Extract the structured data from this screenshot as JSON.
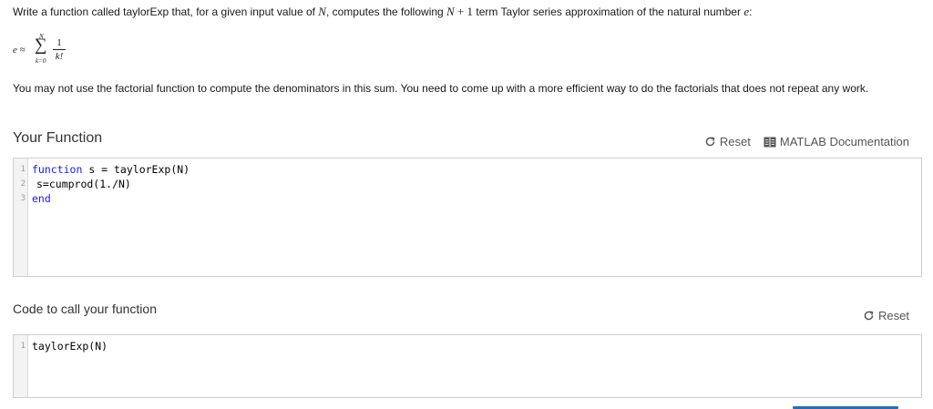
{
  "problem": {
    "text_1": "Write a function called taylorExp that, for a given input value of ",
    "var_N": "N",
    "text_2": ", computes the following ",
    "expr_N": "N",
    "expr_plus": " + 1",
    "text_3": " term Taylor series approximation of the natural number ",
    "var_e": "e",
    "text_4": ":",
    "formula": {
      "lhs": "e ≈",
      "sigma": "∑",
      "upper": "N",
      "lower": "k=0",
      "numerator": "1",
      "denominator": "k!"
    },
    "note": "You may not use the factorial function to compute the denominators in this sum.  You need to come up with a more efficient way to do the factorials that does not repeat any work."
  },
  "function_section": {
    "title": "Your Function",
    "reset_label": "Reset",
    "docs_label": "MATLAB Documentation",
    "lines": [
      {
        "num": "1",
        "keyword": "function",
        "rest": " s = taylorExp(N)"
      },
      {
        "num": "2",
        "keyword": "",
        "rest": "s=cumprod(1./N)"
      },
      {
        "num": "3",
        "keyword": "end",
        "rest": ""
      }
    ]
  },
  "call_section": {
    "title": "Code to call your function",
    "reset_label": "Reset",
    "lines": [
      {
        "num": "1",
        "rest": "taylorExp(N)"
      }
    ]
  },
  "colors": {
    "keyword": "#1a1af0",
    "accent": "#1f6fb5",
    "border": "#cfcfcf"
  },
  "icons": {
    "reset": "reset-icon",
    "docs": "documentation-icon"
  }
}
